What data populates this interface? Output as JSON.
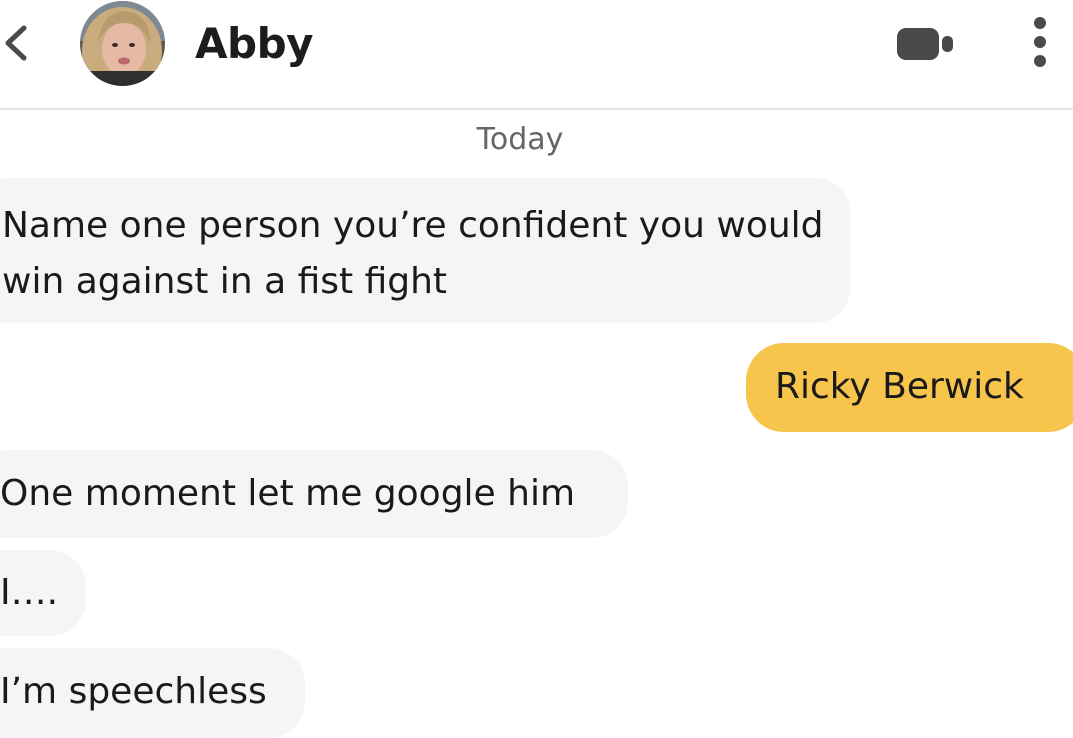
{
  "header": {
    "back_icon": "chevron-left-icon",
    "contact_name": "Abby",
    "video_icon": "video-camera-icon",
    "more_icon": "more-vertical-icon"
  },
  "conversation": {
    "date_separator": "Today",
    "messages": [
      {
        "direction": "incoming",
        "text": "Name one person you’re confident you would win against in a fist fight"
      },
      {
        "direction": "outgoing",
        "text": "Ricky Berwick"
      },
      {
        "direction": "incoming",
        "text": "One moment let me google him"
      },
      {
        "direction": "incoming",
        "text": "I…."
      },
      {
        "direction": "incoming",
        "text": "I’m speechless"
      }
    ]
  },
  "colors": {
    "incoming_bubble": "#f5f5f5",
    "outgoing_bubble": "#f7c54c",
    "text": "#1a1a1a",
    "icon": "#4a4a4a",
    "date": "#666666"
  }
}
